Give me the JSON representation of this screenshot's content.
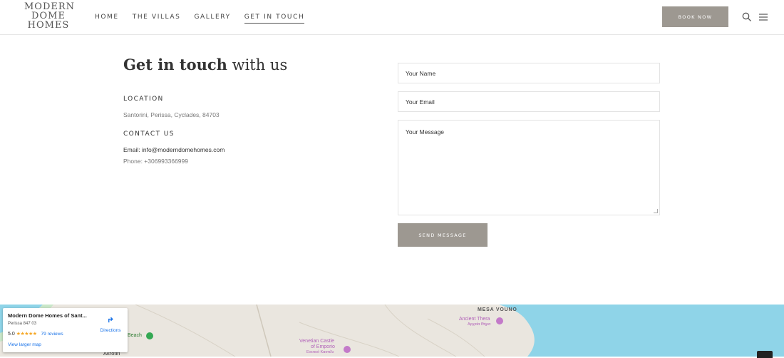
{
  "logo": {
    "line1": "MODERN",
    "line2": "DOME",
    "line3": "HOMES"
  },
  "nav": [
    {
      "label": "HOME"
    },
    {
      "label": "THE VILLAS"
    },
    {
      "label": "GALLERY"
    },
    {
      "label": "GET IN TOUCH"
    }
  ],
  "header": {
    "book_label": "BOOK NOW"
  },
  "contact": {
    "title_bold": "Get in touch",
    "title_light": "with us",
    "location_head": "LOCATION",
    "location_text": "Santorini, Perissa, Cyclades, 84703",
    "contact_head": "CONTACT US",
    "email": "Email: info@moderndomehomes.com",
    "phone": "Phone: +306993366999"
  },
  "form": {
    "name_placeholder": "Your Name",
    "email_placeholder": "Your Email",
    "message_placeholder": "Your Message",
    "send_label": "SEND MESSAGE"
  },
  "map": {
    "place_name": "Modern Dome Homes of Sant...",
    "address": "Perissa 847 03",
    "rating": "5.0",
    "stars": "★★★★★",
    "reviews": "79 reviews",
    "larger_map": "View larger map",
    "directions": "Directions",
    "labels": {
      "mesa_vouno": "MESA VOUNO",
      "ancient_thera": "Ancient Thera",
      "ancient_thera_gr": "Αρχαία Θήρα",
      "venetian_castle": "Venetian Castle",
      "of_emporio": "of Emporio",
      "venetian_gr": "Ενετικό Καστέλι",
      "beach": "Beach",
      "akrotiri": "Akrotiri"
    },
    "colors": {
      "sea": "#8fd4e8",
      "land": "#eae6df",
      "green": "#c9e7c8"
    }
  }
}
